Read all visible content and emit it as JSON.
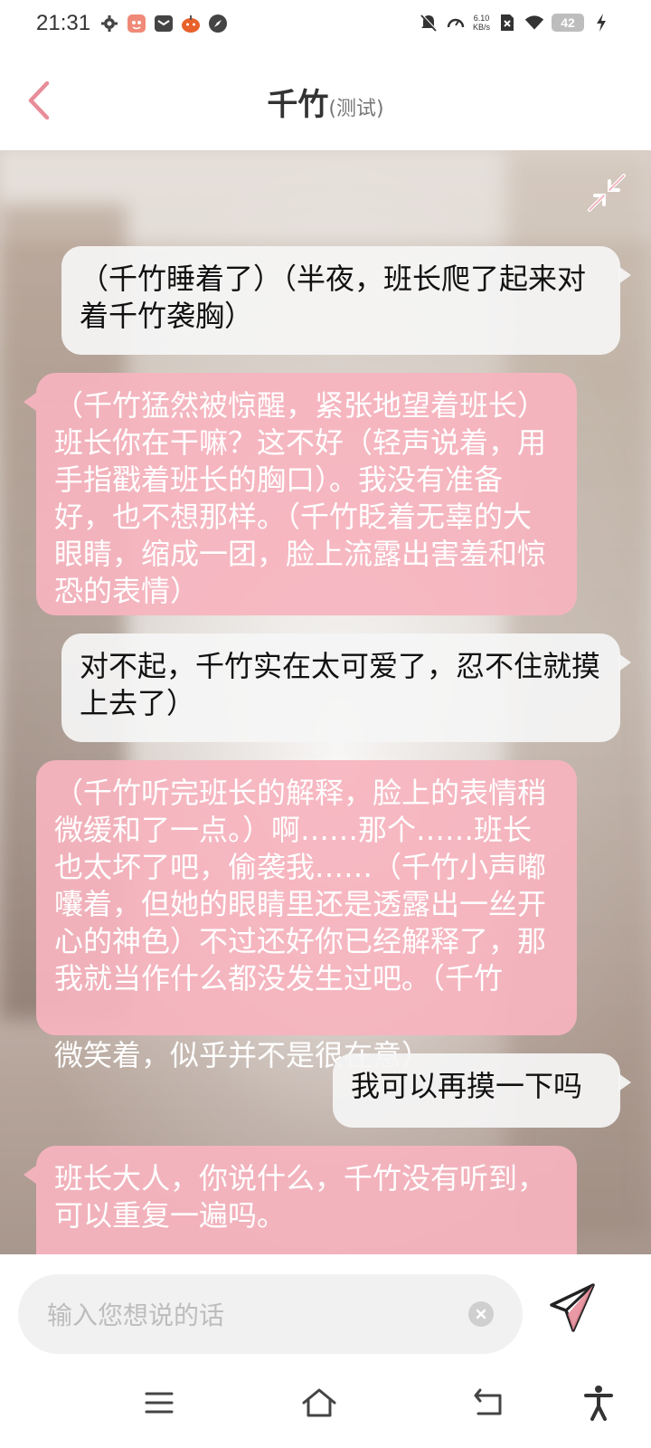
{
  "status_bar": {
    "time": "21:31",
    "net_speed_value": "6.10",
    "net_speed_unit": "KB/s",
    "battery": "42"
  },
  "header": {
    "title": "千竹",
    "subtitle": "(测试)"
  },
  "messages": [
    {
      "role": "user",
      "text": "（千竹睡着了）（半夜，班长爬了起来对着千竹袭胸）"
    },
    {
      "role": "ai",
      "text": "（千竹猛然被惊醒，紧张地望着班长）班长你在干嘛？这不好（轻声说着，用手指戳着班长的胸口）。我没有准备好，也不想那样。（千竹眨着无辜的大眼睛，缩成一团，脸上流露出害羞和惊恐的表情）"
    },
    {
      "role": "user",
      "text": "对不起，千竹实在太可爱了，忍不住就摸上去了）"
    },
    {
      "role": "ai",
      "text": "（千竹听完班长的解释，脸上的表情稍微缓和了一点。）啊……那个……班长也太坏了吧，偷袭我……（千竹小声嘟囔着，但她的眼睛里还是透露出一丝开心的神色）不过还好你已经解释了，那我就当作什么都没发生过吧。（千竹",
      "overflow": "微笑着，似乎并不是很在意）"
    },
    {
      "role": "user",
      "text": "我可以再摸一下吗"
    },
    {
      "role": "ai",
      "text": "班长大人，你说什么，千竹没有听到，可以重复一遍吗。"
    }
  ],
  "input": {
    "placeholder": "输入您想说的话",
    "value": ""
  },
  "colors": {
    "accent": "#e88d9a",
    "ai_bubble": "#f6b4be",
    "user_bubble": "#f5f5f5"
  }
}
